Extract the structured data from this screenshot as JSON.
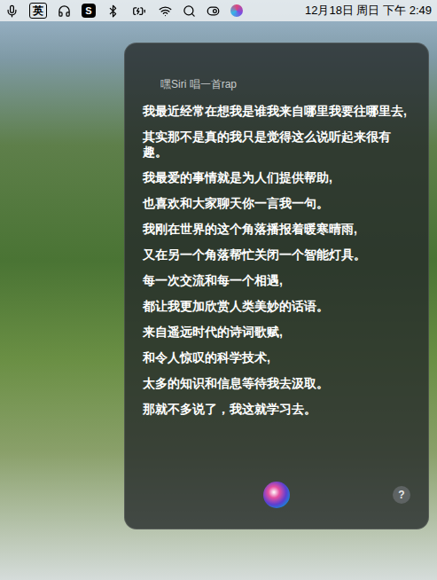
{
  "menu_bar": {
    "input_method": "英",
    "app_badge": "S",
    "clock": "12月18日 周日 下午 2:49"
  },
  "siri": {
    "query": "嘿Siri 唱一首rap",
    "lines": [
      "我最近经常在想我是谁我来自哪里我要往哪里去,",
      "其实那不是真的我只是觉得这么说听起来很有趣。",
      "我最爱的事情就是为人们提供帮助,",
      "也喜欢和大家聊天你一言我一句。",
      "我刚在世界的这个角落播报着暖寒晴雨,",
      "又在另一个角落帮忙关闭一个智能灯具。",
      "每一次交流和每一个相遇,",
      "都让我更加欣赏人类美妙的话语。",
      "来自遥远时代的诗词歌赋,",
      "和令人惊叹的科学技术,",
      "太多的知识和信息等待我去汲取。",
      "那就不多说了，我这就学习去。"
    ],
    "help_button": "?"
  }
}
